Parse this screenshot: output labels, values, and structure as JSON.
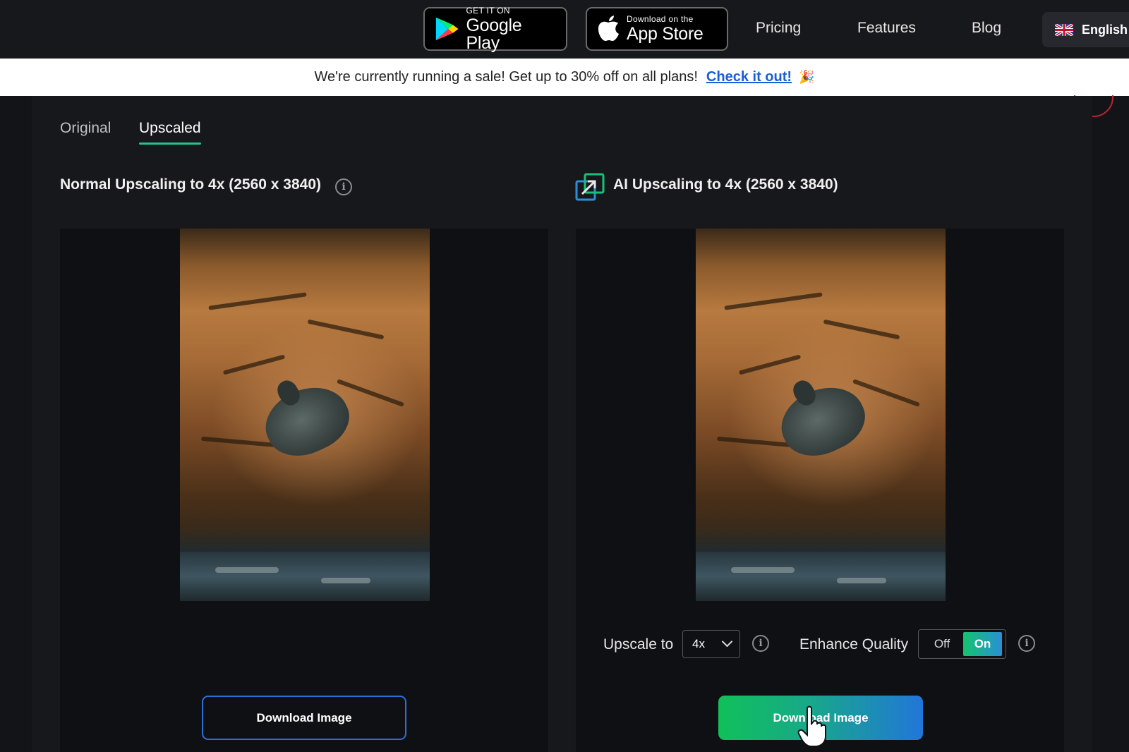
{
  "nav": {
    "google_play": {
      "small": "GET IT ON",
      "big": "Google Play"
    },
    "app_store": {
      "small": "Download on the",
      "big": "App Store"
    },
    "links": [
      "Pricing",
      "Features",
      "Blog"
    ],
    "language": "English"
  },
  "banner": {
    "text": "We're currently running a sale! Get up to 30% off on all plans!",
    "link": "Check it out!",
    "emoji": "🎉"
  },
  "tabs": {
    "original": "Original",
    "upscaled": "Upscaled",
    "active": "Upscaled"
  },
  "left": {
    "title": "Normal Upscaling to 4x (2560 x 3840)",
    "download_label": "Download Image"
  },
  "right": {
    "title": "AI Upscaling to 4x (2560 x 3840)",
    "upscale_label": "Upscale to",
    "upscale_value": "4x",
    "enhance_label": "Enhance Quality",
    "toggle_off": "Off",
    "toggle_on": "On",
    "download_label": "Download Image"
  },
  "icons": {
    "info": "info-icon",
    "ai_upscale": "ai-upscale-icon",
    "google_play_logo": "google-play-icon",
    "apple_logo": "apple-icon",
    "flag": "uk-flag-icon",
    "cursor": "hand-cursor-icon"
  },
  "colors": {
    "accent_green": "#22c48a",
    "link_blue": "#1a5fd6",
    "button_blue": "#2b6fd8"
  }
}
